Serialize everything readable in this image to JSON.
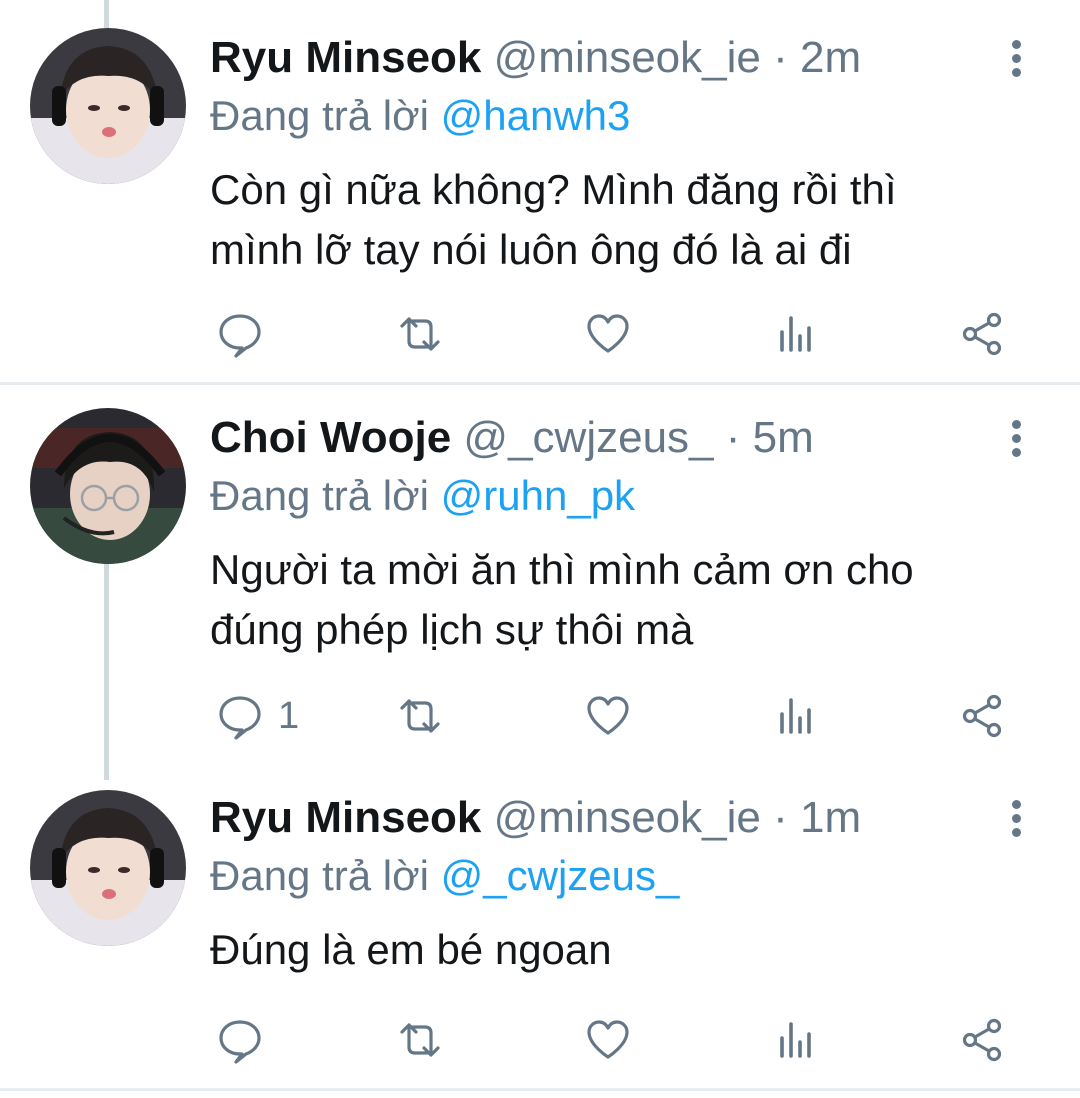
{
  "tweets": [
    {
      "name": "Ryu Minseok",
      "handle": "@minseok_ie",
      "sep": " · ",
      "time": "2m",
      "reply_prefix": "Đang trả lời ",
      "reply_to": "@hanwh3",
      "text_lines": [
        "Còn gì nữa không? Mình đăng rồi thì",
        "mình lỡ tay nói luôn ông đó là ai đi"
      ],
      "reply_count": ""
    },
    {
      "name": "Choi Wooje",
      "handle": "@_cwjzeus_",
      "sep": " · ",
      "time": "5m",
      "reply_prefix": "Đang trả lời ",
      "reply_to": "@ruhn_pk",
      "text_lines": [
        "Người ta mời ăn thì mình cảm ơn cho",
        "đúng phép lịch sự thôi mà"
      ],
      "reply_count": "1"
    },
    {
      "name": "Ryu Minseok",
      "handle": "@minseok_ie",
      "sep": " · ",
      "time": "1m",
      "reply_prefix": "Đang trả lời ",
      "reply_to": "@_cwjzeus_",
      "text_lines": [
        "Đúng là em bé ngoan"
      ],
      "reply_count": ""
    }
  ],
  "icons": {
    "reply": "reply-bubble-icon",
    "retweet": "retweet-icon",
    "like": "heart-icon",
    "analytics": "analytics-bars-icon",
    "share": "share-icon",
    "more": "more-vertical-icon"
  },
  "colors": {
    "text": "#14171a",
    "secondary": "#657786",
    "mention": "#1da1f2",
    "divider": "#e6ecf0",
    "thread_line": "#cfd9de"
  }
}
